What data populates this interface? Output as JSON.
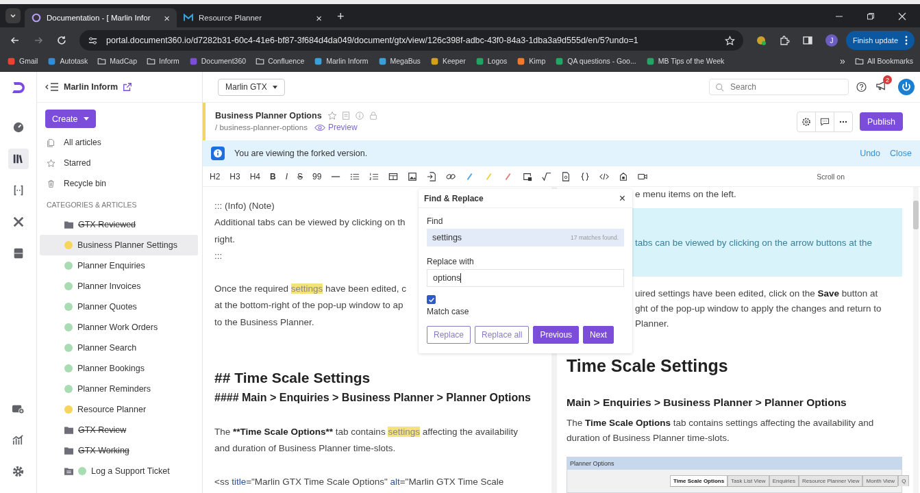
{
  "browser": {
    "tabs": [
      {
        "title": "Documentation - [ Marlin Infor",
        "selected": true,
        "close": "×"
      },
      {
        "title": "Resource Planner",
        "selected": false,
        "close": "×"
      }
    ],
    "new_tab": "+",
    "url": "portal.document360.io/d7282b31-60c4-41e6-bf87-3f684d4da049/document/gtx/view/126c398f-adbc-43f0-84a3-1dba3a9d555d/en/5?undo=1",
    "profile": "J",
    "finish_update": "Finish update",
    "bookmarks": [
      {
        "label": "Gmail",
        "kind": "site",
        "color": "#ea4335"
      },
      {
        "label": "Autotask",
        "kind": "site",
        "color": "#2d8ee0"
      },
      {
        "label": "MadCap",
        "kind": "folder"
      },
      {
        "label": "Inform",
        "kind": "folder"
      },
      {
        "label": "Document360",
        "kind": "site",
        "color": "#7c4ddb"
      },
      {
        "label": "Confluence",
        "kind": "folder"
      },
      {
        "label": "Marlin Inform",
        "kind": "site",
        "color": "#3aa0d8"
      },
      {
        "label": "MegaBus",
        "kind": "site",
        "color": "#3aa0d8"
      },
      {
        "label": "Keeper",
        "kind": "site",
        "color": "#d4a017"
      },
      {
        "label": "Logos",
        "kind": "site",
        "color": "#1fa463"
      },
      {
        "label": "Kimp",
        "kind": "site",
        "color": "#f07a2a"
      },
      {
        "label": "QA questions - Goo...",
        "kind": "site",
        "color": "#23a566"
      },
      {
        "label": "MB Tips of the Week",
        "kind": "site",
        "color": "#23a566"
      }
    ],
    "more": "»",
    "all_bookmarks": "All Bookmarks"
  },
  "rail": [
    {
      "selected": false
    },
    {
      "selected": true
    },
    {
      "selected": false
    },
    {
      "selected": false
    },
    {
      "selected": false
    }
  ],
  "sidebar": {
    "workspace": "Marlin Inform",
    "create": "Create",
    "nav": [
      {
        "label": "All articles"
      },
      {
        "label": "Starred"
      },
      {
        "label": "Recycle bin"
      }
    ],
    "section": "CATEGORIES & ARTICLES",
    "tree": [
      {
        "label": "GTX Reviewed",
        "kind": "folder",
        "struck": true,
        "selected": false
      },
      {
        "label": "Business Planner Settings",
        "kind": "article",
        "color": "#f7d45c",
        "struck": false,
        "selected": true
      },
      {
        "label": "Planner Enquiries",
        "kind": "article",
        "color": "#a9dcb3",
        "struck": false,
        "selected": false
      },
      {
        "label": "Planner Invoices",
        "kind": "article",
        "color": "#a9dcb3",
        "struck": false,
        "selected": false
      },
      {
        "label": "Planner Quotes",
        "kind": "article",
        "color": "#a9dcb3",
        "struck": false,
        "selected": false
      },
      {
        "label": "Planner Work Orders",
        "kind": "article",
        "color": "#a9dcb3",
        "struck": false,
        "selected": false
      },
      {
        "label": "Planner Search",
        "kind": "article",
        "color": "#a9dcb3",
        "struck": false,
        "selected": false
      },
      {
        "label": "Planner Bookings",
        "kind": "article",
        "color": "#a9dcb3",
        "struck": false,
        "selected": false
      },
      {
        "label": "Planner Reminders",
        "kind": "article",
        "color": "#a9dcb3",
        "struck": false,
        "selected": false
      },
      {
        "label": "Resource Planner",
        "kind": "article",
        "color": "#f7d45c",
        "struck": false,
        "selected": false
      },
      {
        "label": "GTX Review",
        "kind": "folder",
        "struck": true,
        "selected": false
      },
      {
        "label": "GTX Working",
        "kind": "folder",
        "struck": true,
        "selected": false
      },
      {
        "label": "Log a Support Ticket",
        "kind": "category-page",
        "color": "#a9dcb3",
        "struck": false,
        "selected": false
      }
    ]
  },
  "header": {
    "version": "Marlin GTX",
    "search_placeholder": "Search",
    "notifications": "2"
  },
  "article": {
    "title": "Business Planner Options",
    "slug": "/ business-planner-options",
    "preview": "Preview",
    "publish": "Publish"
  },
  "banner": {
    "text": "You are viewing the forked version.",
    "links": [
      "Undo",
      "Close"
    ]
  },
  "toolbar": {
    "text_buttons": [
      "H2",
      "H3",
      "H4",
      "B",
      "I",
      "S",
      "99"
    ],
    "scroll": "Scroll on"
  },
  "editor": [
    {
      "kind": "line",
      "segs": [
        {
          "t": "::: (Info) (Note)",
          "kind": "text"
        }
      ]
    },
    {
      "kind": "line",
      "segs": [
        {
          "t": "Additional tabs can be viewed by clicking on th",
          "kind": "text"
        }
      ]
    },
    {
      "kind": "line",
      "segs": [
        {
          "t": "right.",
          "kind": "text"
        }
      ]
    },
    {
      "kind": "line",
      "segs": [
        {
          "t": ":::",
          "kind": "text"
        }
      ]
    },
    {
      "kind": "gap"
    },
    {
      "kind": "line",
      "segs": [
        {
          "t": "Once the required ",
          "kind": "text"
        },
        {
          "t": "settings",
          "kind": "match"
        },
        {
          "t": " have been edited, c",
          "kind": "text"
        }
      ]
    },
    {
      "kind": "line",
      "segs": [
        {
          "t": "at the bottom-right of the pop-up window to ap",
          "kind": "text"
        }
      ]
    },
    {
      "kind": "line",
      "segs": [
        {
          "t": "to the Business Planner.",
          "kind": "text"
        }
      ]
    },
    {
      "kind": "gap"
    },
    {
      "kind": "gap"
    },
    {
      "kind": "h2",
      "segs": [
        {
          "t": "## Time Scale Settings",
          "kind": "text"
        }
      ]
    },
    {
      "kind": "h4",
      "segs": [
        {
          "t": "#### Main > Enquiries > Business Planner > Planner Options",
          "kind": "text"
        }
      ]
    },
    {
      "kind": "gap"
    },
    {
      "kind": "line",
      "segs": [
        {
          "t": "The ",
          "kind": "text"
        },
        {
          "t": "**Time Scale Options**",
          "kind": "bold"
        },
        {
          "t": " tab contains ",
          "kind": "text"
        },
        {
          "t": "settings",
          "kind": "match"
        },
        {
          "t": " affecting the availability",
          "kind": "text"
        }
      ]
    },
    {
      "kind": "line",
      "segs": [
        {
          "t": "and duration of Business Planner time-slots.",
          "kind": "text"
        }
      ]
    },
    {
      "kind": "gap"
    },
    {
      "kind": "line",
      "segs": [
        {
          "t": "<ss ",
          "kind": "text"
        },
        {
          "t": "title",
          "kind": "attr"
        },
        {
          "t": "=\"Marlin GTX Time Scale Options\" ",
          "kind": "text"
        },
        {
          "t": "alt",
          "kind": "attr"
        },
        {
          "t": "=\"Marlin GTX Time Scale",
          "kind": "text"
        }
      ]
    }
  ],
  "preview": {
    "top_line": "e menu items on the left.",
    "callout": "tabs can be viewed by clicking on the arrow buttons at the",
    "para_lines": [
      "uired settings have been edited, click on the **Save** button at",
      "ght of the pop-up window to apply the changes and return to",
      "Planner."
    ],
    "heading": "Time Scale Settings",
    "subheading": "Main > Enquiries > Business Planner > Planner Options",
    "body": [
      "The **Time Scale Options** tab contains settings affecting the availability and",
      "duration of Business Planner time-slots."
    ],
    "screenshot": {
      "title": "Planner Options",
      "tabs": [
        {
          "label": "Time Scale Options",
          "selected": true
        },
        {
          "label": "Task List View",
          "selected": false
        },
        {
          "label": "Enquiries",
          "selected": false
        },
        {
          "label": "Resource Planner View",
          "selected": false
        },
        {
          "label": "Month View",
          "selected": false
        },
        {
          "label": "Q",
          "selected": false
        }
      ]
    }
  },
  "find_replace": {
    "title": "Find & Replace",
    "close": "×",
    "find_label": "Find",
    "find_value": "settings",
    "matches": "17 matches found.",
    "replace_label": "Replace with",
    "replace_value": "options",
    "match_case": {
      "label": "Match case",
      "checked": true
    },
    "buttons": [
      {
        "label": "Replace",
        "kind": "outline"
      },
      {
        "label": "Replace all",
        "kind": "outline"
      },
      {
        "label": "Previous",
        "kind": "primary"
      },
      {
        "label": "Next",
        "kind": "primary"
      }
    ]
  }
}
